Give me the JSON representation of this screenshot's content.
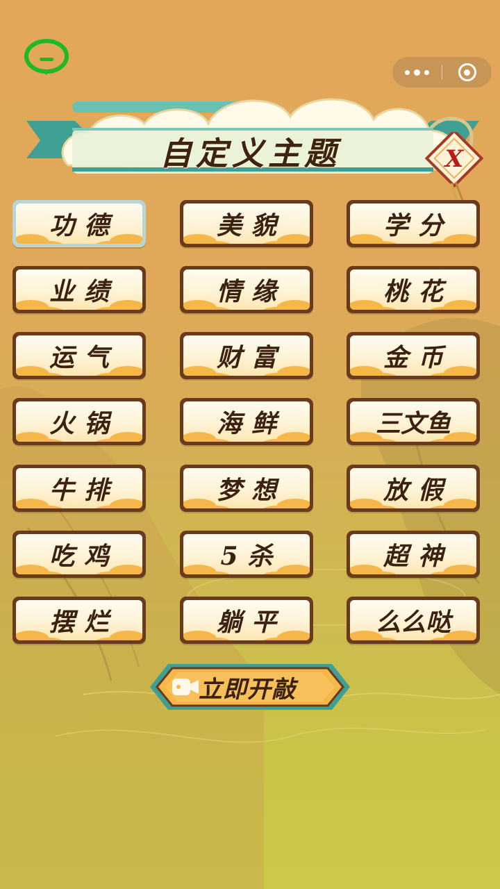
{
  "header": {
    "title": "自定义主题"
  },
  "capsule": {
    "more_icon": "more-dots-icon",
    "close_icon": "target-circle-icon"
  },
  "close_button": {
    "label": "X"
  },
  "themes": [
    {
      "label": "功德",
      "selected": true
    },
    {
      "label": "美貌",
      "selected": false
    },
    {
      "label": "学分",
      "selected": false
    },
    {
      "label": "业绩",
      "selected": false
    },
    {
      "label": "情缘",
      "selected": false
    },
    {
      "label": "桃花",
      "selected": false
    },
    {
      "label": "运气",
      "selected": false
    },
    {
      "label": "财富",
      "selected": false
    },
    {
      "label": "金币",
      "selected": false
    },
    {
      "label": "火锅",
      "selected": false
    },
    {
      "label": "海鲜",
      "selected": false
    },
    {
      "label": "三文鱼",
      "selected": false
    },
    {
      "label": "牛排",
      "selected": false
    },
    {
      "label": "梦想",
      "selected": false
    },
    {
      "label": "放假",
      "selected": false
    },
    {
      "label": "吃鸡",
      "selected": false
    },
    {
      "label": "5杀",
      "selected": false
    },
    {
      "label": "超神",
      "selected": false
    },
    {
      "label": "摆烂",
      "selected": false
    },
    {
      "label": "躺平",
      "selected": false
    },
    {
      "label": "么么哒",
      "selected": false
    }
  ],
  "start_button": {
    "label": "立即开敲",
    "icon": "video-camera-icon"
  },
  "colors": {
    "frame": "#6a3a1c",
    "accent": "#f5b64a",
    "selected_frame": "#b8d6d8",
    "text": "#3a2110",
    "banner_teal": "#3f9f92"
  }
}
